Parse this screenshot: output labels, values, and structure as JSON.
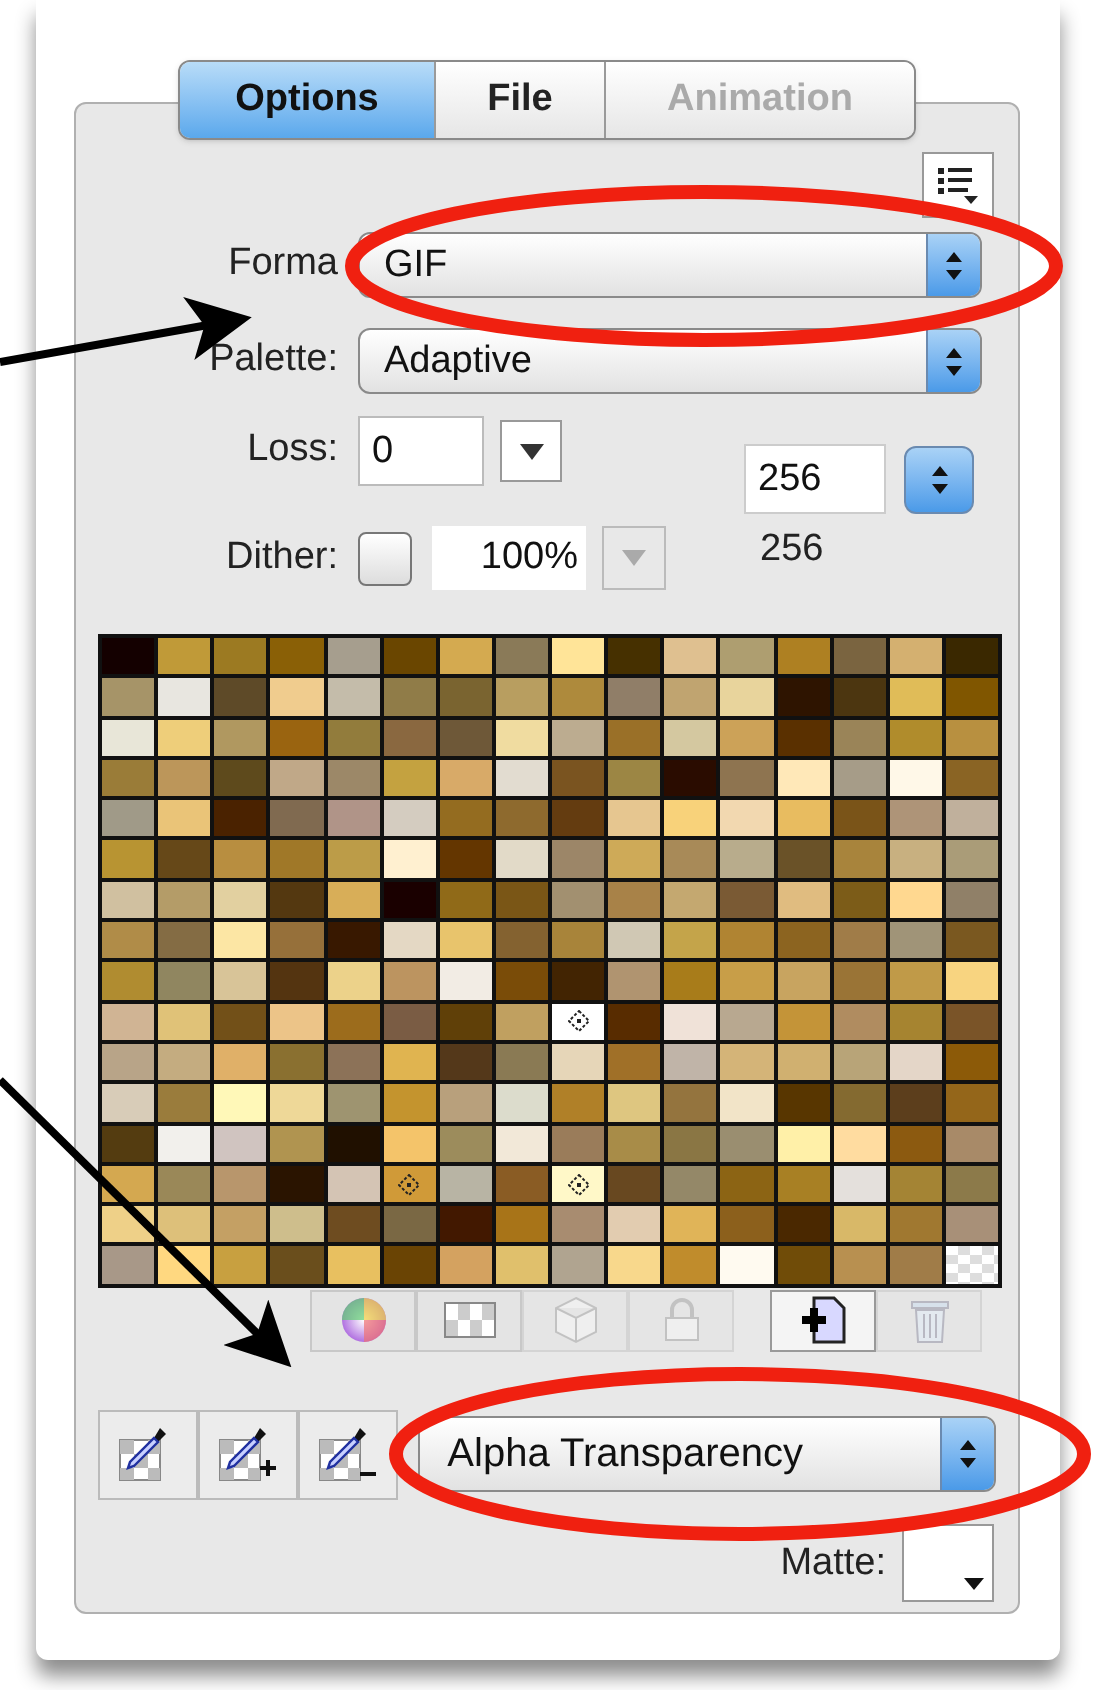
{
  "tabs": [
    {
      "label": "Options",
      "selected": true,
      "disabled": false
    },
    {
      "label": "File",
      "selected": false,
      "disabled": false
    },
    {
      "label": "Animation",
      "selected": false,
      "disabled": true
    }
  ],
  "format": {
    "label": "Forma",
    "value": "GIF"
  },
  "palette": {
    "label": "Palette:",
    "value": "Adaptive"
  },
  "loss": {
    "label": "Loss:",
    "value": "0"
  },
  "colors": {
    "value": "256",
    "count": "256"
  },
  "dither": {
    "label": "Dither:",
    "checked": false,
    "amount": "100%"
  },
  "color_table": {
    "transparent_last": true,
    "rows": [
      {
        "swatches": [
          {
            "color": "#140000"
          },
          {
            "color": "#c09a38"
          },
          {
            "color": "#9c7a22"
          },
          {
            "color": "#8a6006"
          },
          {
            "color": "#a69e8e"
          },
          {
            "color": "#6a4600"
          },
          {
            "color": "#d4aa50"
          },
          {
            "color": "#8a7a58"
          },
          {
            "color": "#ffe498"
          },
          {
            "color": "#463000"
          },
          {
            "color": "#dfc090"
          },
          {
            "color": "#ae9e70"
          },
          {
            "color": "#ae8022"
          },
          {
            "color": "#7a6440"
          },
          {
            "color": "#d4b070"
          },
          {
            "color": "#3a2800"
          }
        ]
      },
      {
        "swatches": [
          {
            "color": "#a69468"
          },
          {
            "color": "#e8e6e0"
          },
          {
            "color": "#5e4a28"
          },
          {
            "color": "#f0cc8e"
          },
          {
            "color": "#c4bcaa"
          },
          {
            "color": "#907c48"
          },
          {
            "color": "#7a6430"
          },
          {
            "color": "#b89e60"
          },
          {
            "color": "#ae8a3c"
          },
          {
            "color": "#907e68"
          },
          {
            "color": "#c0a470"
          },
          {
            "color": "#e8d49c"
          },
          {
            "color": "#2e1400"
          },
          {
            "color": "#4c3610"
          },
          {
            "color": "#e0bc58"
          },
          {
            "color": "#805600"
          }
        ]
      },
      {
        "swatches": [
          {
            "color": "#e8e6d8"
          },
          {
            "color": "#eece7a"
          },
          {
            "color": "#b09860"
          },
          {
            "color": "#9a6410"
          },
          {
            "color": "#927c3c"
          },
          {
            "color": "#8a6840"
          },
          {
            "color": "#6e5838"
          },
          {
            "color": "#f0dca0"
          },
          {
            "color": "#bcac90"
          },
          {
            "color": "#9a7028"
          },
          {
            "color": "#d4c8a0"
          },
          {
            "color": "#cca258"
          },
          {
            "color": "#5a3000"
          },
          {
            "color": "#9a8458"
          },
          {
            "color": "#b08c2c"
          },
          {
            "color": "#b89040"
          }
        ]
      },
      {
        "swatches": [
          {
            "color": "#9a7c38"
          },
          {
            "color": "#bc965a"
          },
          {
            "color": "#5e4a1c"
          },
          {
            "color": "#c0a888"
          },
          {
            "color": "#9c8868"
          },
          {
            "color": "#c4a240"
          },
          {
            "color": "#d8aa68"
          },
          {
            "color": "#e2dcd0"
          },
          {
            "color": "#7a5420"
          },
          {
            "color": "#9c8644"
          },
          {
            "color": "#2a0c00"
          },
          {
            "color": "#8e7450"
          },
          {
            "color": "#ffe8b8"
          },
          {
            "color": "#a69c88"
          },
          {
            "color": "#fff8e8"
          },
          {
            "color": "#8a6424"
          }
        ]
      },
      {
        "swatches": [
          {
            "color": "#a09a88"
          },
          {
            "color": "#eac478"
          },
          {
            "color": "#4a2200"
          },
          {
            "color": "#806a50"
          },
          {
            "color": "#b09488"
          },
          {
            "color": "#d4ccc0"
          },
          {
            "color": "#946c20"
          },
          {
            "color": "#8e6a2e"
          },
          {
            "color": "#643c10"
          },
          {
            "color": "#e6c690"
          },
          {
            "color": "#f8d27a"
          },
          {
            "color": "#f2d8b0"
          },
          {
            "color": "#e8bc60"
          },
          {
            "color": "#7a5418"
          },
          {
            "color": "#ae9478"
          },
          {
            "color": "#c0b09c"
          }
        ]
      },
      {
        "swatches": [
          {
            "color": "#b89432"
          },
          {
            "color": "#664818"
          },
          {
            "color": "#b88e40"
          },
          {
            "color": "#a07828"
          },
          {
            "color": "#bc9c48"
          },
          {
            "color": "#fff0d0"
          },
          {
            "color": "#643600"
          },
          {
            "color": "#e2dac8"
          },
          {
            "color": "#9c8668"
          },
          {
            "color": "#ceaa58"
          },
          {
            "color": "#a88a58"
          },
          {
            "color": "#b8ac8c"
          },
          {
            "color": "#6a5228"
          },
          {
            "color": "#a8843c"
          },
          {
            "color": "#c8b080"
          },
          {
            "color": "#aa9c78"
          }
        ]
      },
      {
        "swatches": [
          {
            "color": "#d0c0a0"
          },
          {
            "color": "#b49c68"
          },
          {
            "color": "#e2d0a0"
          },
          {
            "color": "#543810"
          },
          {
            "color": "#d8ae58"
          },
          {
            "color": "#1a0000"
          },
          {
            "color": "#906a18"
          },
          {
            "color": "#7a5616"
          },
          {
            "color": "#a29070"
          },
          {
            "color": "#a88248"
          },
          {
            "color": "#c4a870"
          },
          {
            "color": "#7a5a34"
          },
          {
            "color": "#e0bc80"
          },
          {
            "color": "#7c5c18"
          },
          {
            "color": "#ffd890"
          },
          {
            "color": "#908068"
          }
        ]
      },
      {
        "swatches": [
          {
            "color": "#b08c48"
          },
          {
            "color": "#846c44"
          },
          {
            "color": "#fce6a4"
          },
          {
            "color": "#96703a"
          },
          {
            "color": "#381800"
          },
          {
            "color": "#e4d8c4"
          },
          {
            "color": "#e8c46c"
          },
          {
            "color": "#846230"
          },
          {
            "color": "#a8843a"
          },
          {
            "color": "#d0c8b4"
          },
          {
            "color": "#c4a44a"
          },
          {
            "color": "#b08432"
          },
          {
            "color": "#8c6420"
          },
          {
            "color": "#a07c48"
          },
          {
            "color": "#a09478"
          },
          {
            "color": "#7a5820"
          }
        ]
      },
      {
        "swatches": [
          {
            "color": "#b08c30"
          },
          {
            "color": "#908660"
          },
          {
            "color": "#d8c498"
          },
          {
            "color": "#543410"
          },
          {
            "color": "#ecd28a"
          },
          {
            "color": "#bc9460"
          },
          {
            "color": "#f2ece4"
          },
          {
            "color": "#7a4c08"
          },
          {
            "color": "#422402"
          },
          {
            "color": "#b09470"
          },
          {
            "color": "#a87c1a"
          },
          {
            "color": "#c89e48"
          },
          {
            "color": "#c8a460"
          },
          {
            "color": "#9a7436"
          },
          {
            "color": "#c09a48"
          },
          {
            "color": "#f8d480"
          }
        ]
      },
      {
        "swatches": [
          {
            "color": "#d0b494",
            "marked": false
          },
          {
            "color": "#e0c278",
            "marked": false
          },
          {
            "color": "#725018",
            "marked": false
          },
          {
            "color": "#ecc488",
            "marked": false
          },
          {
            "color": "#9c6c1c",
            "marked": false
          },
          {
            "color": "#7a5c44",
            "marked": false
          },
          {
            "color": "#604008",
            "marked": false
          },
          {
            "color": "#c0a060",
            "marked": false
          },
          {
            "color": "#ffffff",
            "marked": true
          },
          {
            "color": "#582c00",
            "marked": false
          },
          {
            "color": "#f0e2d8",
            "marked": false
          },
          {
            "color": "#b8a890",
            "marked": false
          },
          {
            "color": "#c49438",
            "marked": false
          },
          {
            "color": "#b08c60",
            "marked": false
          },
          {
            "color": "#a68430",
            "marked": false
          },
          {
            "color": "#7a5428",
            "marked": false
          }
        ]
      },
      {
        "swatches": [
          {
            "color": "#b8a488"
          },
          {
            "color": "#c4ac80"
          },
          {
            "color": "#e0b068"
          },
          {
            "color": "#8a7030"
          },
          {
            "color": "#8c7258"
          },
          {
            "color": "#e0b450"
          },
          {
            "color": "#54381a"
          },
          {
            "color": "#8a7a54"
          },
          {
            "color": "#e6d6b8"
          },
          {
            "color": "#a07028"
          },
          {
            "color": "#c0b4a8"
          },
          {
            "color": "#d4b478"
          },
          {
            "color": "#d0b070"
          },
          {
            "color": "#b8a478"
          },
          {
            "color": "#e4d6c8"
          },
          {
            "color": "#8c5a08"
          }
        ]
      },
      {
        "swatches": [
          {
            "color": "#d8ccb8"
          },
          {
            "color": "#9a7c3c"
          },
          {
            "color": "#fff8b8"
          },
          {
            "color": "#eed898"
          },
          {
            "color": "#9e9470"
          },
          {
            "color": "#c4942e"
          },
          {
            "color": "#b8a07c"
          },
          {
            "color": "#dcdccc"
          },
          {
            "color": "#b08028"
          },
          {
            "color": "#dec680"
          },
          {
            "color": "#94743e"
          },
          {
            "color": "#f2e4c8"
          },
          {
            "color": "#583600"
          },
          {
            "color": "#846a30"
          },
          {
            "color": "#5c3e1c"
          },
          {
            "color": "#94661a"
          }
        ]
      },
      {
        "swatches": [
          {
            "color": "#543c10"
          },
          {
            "color": "#f2f0ec"
          },
          {
            "color": "#d0c4c0"
          },
          {
            "color": "#b09450"
          },
          {
            "color": "#201000"
          },
          {
            "color": "#f4c46a"
          },
          {
            "color": "#9c8c5c"
          },
          {
            "color": "#f2e8d8"
          },
          {
            "color": "#9a7c5a"
          },
          {
            "color": "#a88c48"
          },
          {
            "color": "#8a7644"
          },
          {
            "color": "#9a8e70"
          },
          {
            "color": "#fff0a8"
          },
          {
            "color": "#ffdca0"
          },
          {
            "color": "#8c5a10"
          },
          {
            "color": "#a88a68"
          }
        ]
      },
      {
        "swatches": [
          {
            "color": "#d4a850",
            "marked": false
          },
          {
            "color": "#9a8858",
            "marked": false
          },
          {
            "color": "#b8966c",
            "marked": false
          },
          {
            "color": "#2a1400",
            "marked": false
          },
          {
            "color": "#d4c4b4",
            "marked": false
          },
          {
            "color": "#d09a38",
            "marked": true
          },
          {
            "color": "#b8b4a4",
            "marked": false
          },
          {
            "color": "#8a5c24",
            "marked": false
          },
          {
            "color": "#fff8c8",
            "marked": true
          },
          {
            "color": "#684820",
            "marked": false
          },
          {
            "color": "#948868",
            "marked": false
          },
          {
            "color": "#8c6414",
            "marked": false
          },
          {
            "color": "#a88024",
            "marked": false
          },
          {
            "color": "#e4e0dc",
            "marked": false
          },
          {
            "color": "#a48434",
            "marked": false
          },
          {
            "color": "#8c7a4a",
            "marked": false
          }
        ]
      },
      {
        "swatches": [
          {
            "color": "#eed088"
          },
          {
            "color": "#ddc07a"
          },
          {
            "color": "#c4a064"
          },
          {
            "color": "#cebe8c"
          },
          {
            "color": "#6e4c20"
          },
          {
            "color": "#7a6844"
          },
          {
            "color": "#421800"
          },
          {
            "color": "#a87418"
          },
          {
            "color": "#a88c70"
          },
          {
            "color": "#e2ccb0"
          },
          {
            "color": "#e0b458"
          },
          {
            "color": "#8c601c"
          },
          {
            "color": "#4a2800"
          },
          {
            "color": "#d8b868"
          },
          {
            "color": "#a07830"
          },
          {
            "color": "#a89078"
          }
        ]
      },
      {
        "swatches": [
          {
            "color": "#a89888"
          },
          {
            "color": "#ffd880"
          },
          {
            "color": "#c8a040"
          },
          {
            "color": "#6a4e1c"
          },
          {
            "color": "#e8c060"
          },
          {
            "color": "#6a4404"
          },
          {
            "color": "#d4a260"
          },
          {
            "color": "#e0c06c"
          },
          {
            "color": "#b0a490"
          },
          {
            "color": "#f8d88c"
          },
          {
            "color": "#c08c2c"
          },
          {
            "color": "#fffaf0"
          },
          {
            "color": "#704c08"
          },
          {
            "color": "#b89050"
          },
          {
            "color": "#a07c48"
          }
        ]
      }
    ]
  },
  "table_tools": [
    {
      "kind": "wheel",
      "disabled": false
    },
    {
      "kind": "checker",
      "disabled": false
    },
    {
      "kind": "cube",
      "disabled": true
    },
    {
      "kind": "lock",
      "disabled": true
    },
    {
      "kind": "new",
      "disabled": false
    },
    {
      "kind": "trash",
      "disabled": true
    }
  ],
  "eyedroppers": [
    {
      "kind": "plain"
    },
    {
      "kind": "add"
    },
    {
      "kind": "subtract"
    }
  ],
  "transparency": {
    "value": "Alpha Transparency"
  },
  "matte": {
    "label": "Matte:"
  }
}
